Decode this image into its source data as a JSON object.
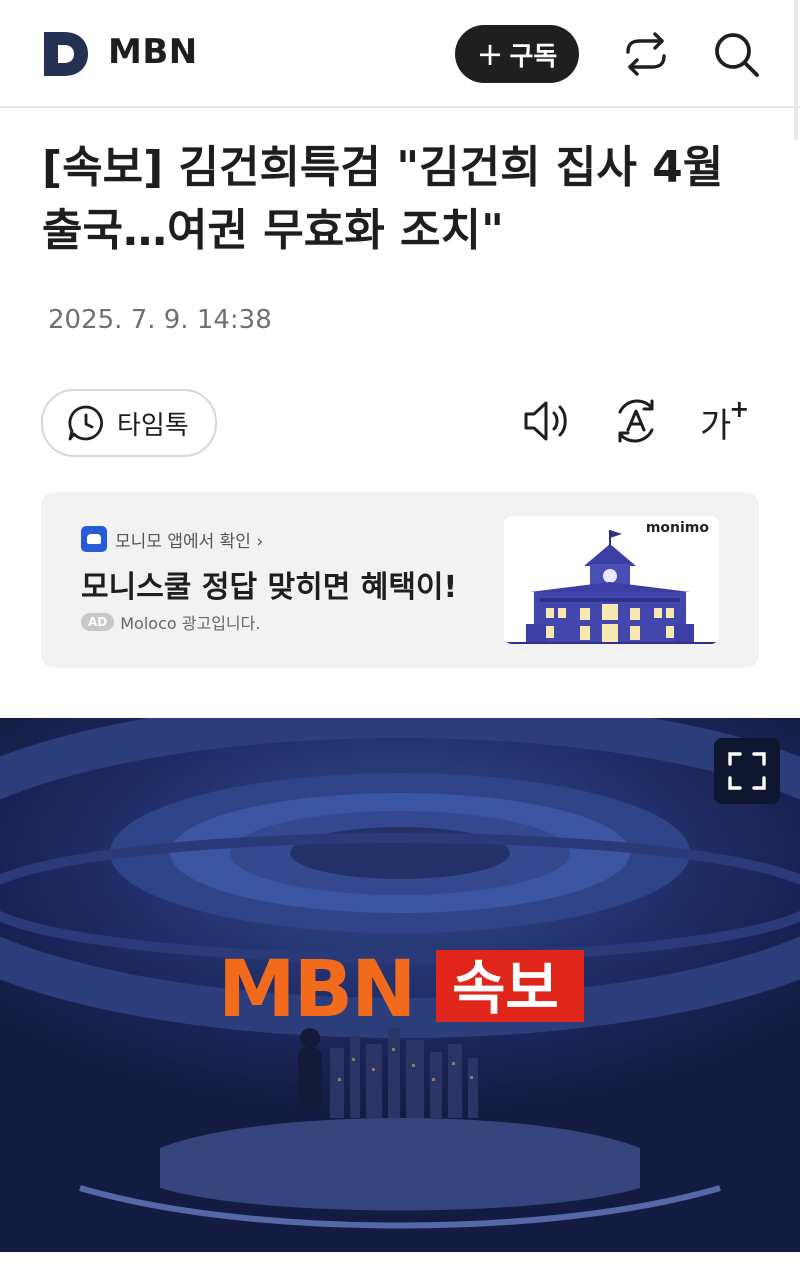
{
  "header": {
    "logo_letter": "D",
    "logo_text": "MBN",
    "subscribe_label": "구독",
    "icons": [
      "share-icon",
      "search-icon"
    ]
  },
  "article": {
    "headline": "[속보] 김건희특검 \"김건희 집사 4월 출국…여권 무효화 조치\"",
    "datetime": "2025. 7. 9. 14:38"
  },
  "toolbar": {
    "timetalk_label": "타임톡",
    "tts_icon": "speaker-icon",
    "translate_icon": "auto-translate-icon",
    "font_label": "가",
    "font_sup": "+"
  },
  "ad": {
    "app_link": "모니모 앱에서 확인 ›",
    "headline": "모니스쿨 정답 맞히면 혜택이!",
    "badge": "AD",
    "sponsor": "Moloco 광고입니다.",
    "image_brand": "monimo"
  },
  "video": {
    "banner_brand": "MBN",
    "banner_label": "속보",
    "fullscreen_icon": "fullscreen-icon",
    "colors": {
      "brand_orange": "#f26a1b",
      "breaking_red": "#e0251b",
      "studio_blue": "#1a2355"
    }
  }
}
